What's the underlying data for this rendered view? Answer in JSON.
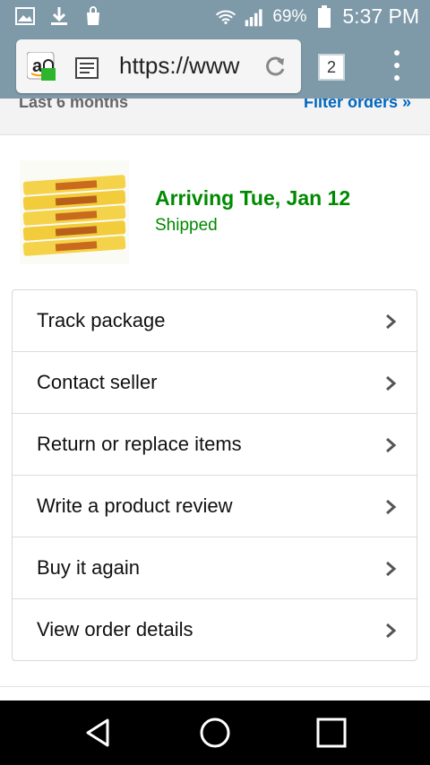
{
  "status_bar": {
    "battery_percent": "69%",
    "time": "5:37 PM",
    "icons": [
      "image-icon",
      "download-icon",
      "bag-icon",
      "wifi-icon",
      "signal-icon",
      "battery-icon"
    ]
  },
  "browser": {
    "url": "https://www",
    "tab_count": "2",
    "icons": [
      "amazon-lock-icon",
      "page-icon",
      "reload-icon",
      "tabs-icon",
      "overflow-menu-icon"
    ]
  },
  "filter": {
    "range_label": "Last 6 months",
    "filter_link": "Filter orders »"
  },
  "shipment": {
    "arrival": "Arriving Tue, Jan 12",
    "status": "Shipped",
    "product_image": "flake-chocolate-bars",
    "status_color": "#008a00"
  },
  "actions": [
    {
      "label": "Track package"
    },
    {
      "label": "Contact seller"
    },
    {
      "label": "Return or replace items"
    },
    {
      "label": "Write a product review"
    },
    {
      "label": "Buy it again"
    },
    {
      "label": "View order details"
    }
  ],
  "nav_bar": {
    "icons": [
      "back-icon",
      "home-icon",
      "recents-icon"
    ]
  },
  "colors": {
    "toolbar": "#7e99a8",
    "link": "#0066c0",
    "green": "#008a00"
  }
}
